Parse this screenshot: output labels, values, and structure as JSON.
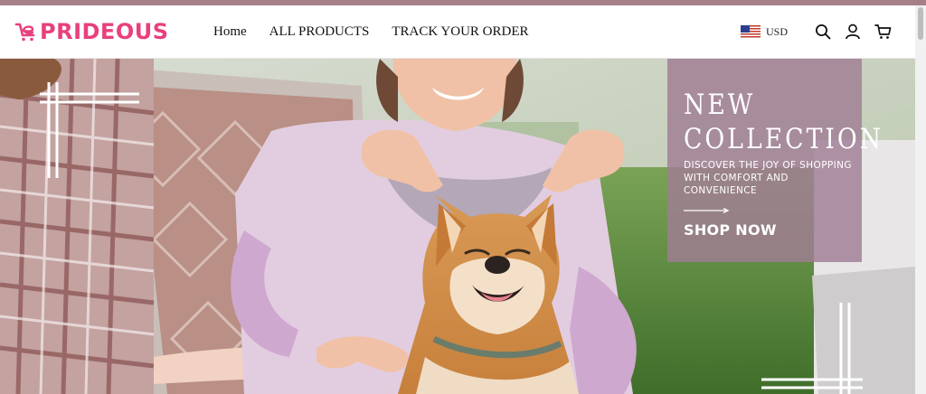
{
  "brand": {
    "name": "PRIDEOUS",
    "color": "#e8407f"
  },
  "nav": {
    "items": [
      {
        "label": "Home"
      },
      {
        "label": "ALL PRODUCTS"
      },
      {
        "label": "TRACK YOUR ORDER"
      }
    ]
  },
  "utilities": {
    "currency": "USD",
    "icons": [
      "us-flag-icon",
      "search-icon",
      "account-icon",
      "cart-icon"
    ]
  },
  "hero": {
    "title": "NEW\nCOLLECTION",
    "subtitle": "DISCOVER THE JOY OF SHOPPING WITH COMFORT AND CONVENIENCE",
    "cta": "SHOP NOW"
  },
  "colors": {
    "accent_bar": "#a77f88",
    "promo_overlay": "#a07d94",
    "brand_pink": "#e8407f"
  }
}
